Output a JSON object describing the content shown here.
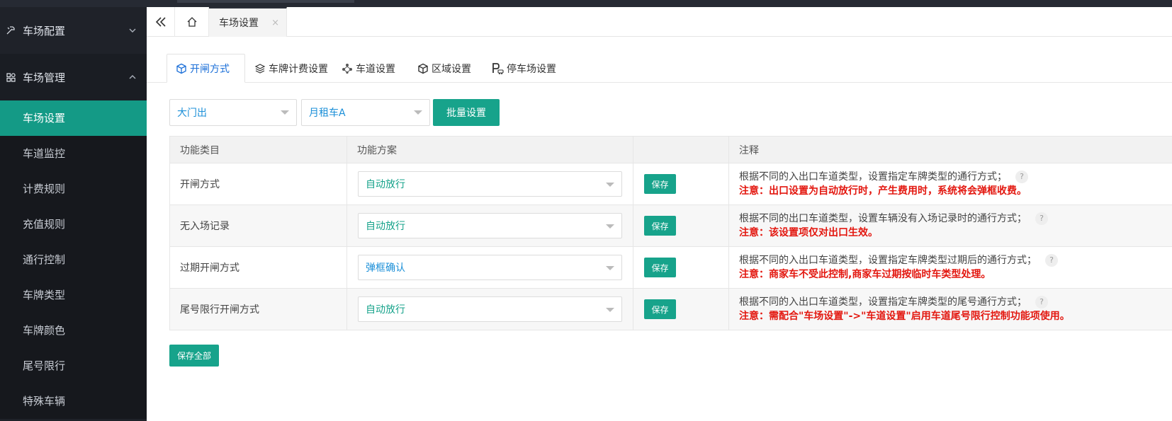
{
  "colors": {
    "accent": "#17a38b",
    "sidebar_bg": "#1f2229",
    "active_tab": "#1b6fd8",
    "warning": "#e3170f"
  },
  "sidebar": {
    "groups": [
      {
        "label": "车场配置",
        "icon": "tools-icon",
        "expanded": false
      },
      {
        "label": "车场管理",
        "icon": "grid-icon",
        "expanded": true
      }
    ],
    "items": [
      {
        "label": "车场设置",
        "active": true
      },
      {
        "label": "车道监控"
      },
      {
        "label": "计费规则"
      },
      {
        "label": "充值规则"
      },
      {
        "label": "通行控制"
      },
      {
        "label": "车牌类型"
      },
      {
        "label": "车牌颜色"
      },
      {
        "label": "尾号限行"
      },
      {
        "label": "特殊车辆"
      }
    ]
  },
  "tabbar": {
    "page_tab": "车场设置",
    "close": "×"
  },
  "subtabs": [
    {
      "label": "开闸方式",
      "icon": "cube-icon",
      "active": true
    },
    {
      "label": "车牌计费设置",
      "icon": "layers-icon"
    },
    {
      "label": "车道设置",
      "icon": "nodes-icon"
    },
    {
      "label": "区域设置",
      "icon": "box-icon"
    },
    {
      "label": "停车场设置",
      "icon": "parking-icon"
    }
  ],
  "filters": {
    "gate": "大门出",
    "car_type": "月租车A",
    "batch_button": "批量设置"
  },
  "table": {
    "headers": [
      "功能类目",
      "功能方案",
      "",
      "注释"
    ],
    "save_label": "保存",
    "rows": [
      {
        "category": "开闸方式",
        "plan": "自动放行",
        "note": "根据不同的入出口车道类型，设置指定车牌类型的通行方式；",
        "warning": "注意：出口设置为自动放行时，产生费用时，系统将会弹框收费。"
      },
      {
        "category": "无入场记录",
        "plan": "自动放行",
        "note": "根据不同的出口车道类型，设置车辆没有入场记录时的通行方式；",
        "warning": "注意：该设置项仅对出口生效。"
      },
      {
        "category": "过期开闸方式",
        "plan": "弹框确认",
        "note": "根据不同的入出口车道类型，设置指定车牌类型过期后的通行方式；",
        "warning": "注意：商家车不受此控制,商家车过期按临时车类型处理。"
      },
      {
        "category": "尾号限行开闸方式",
        "plan": "自动放行",
        "note": "根据不同的入出口车道类型，设置指定车牌类型的尾号通行方式；",
        "warning": "注意：需配合\"车场设置\"->\"车道设置\"启用车道尾号限行控制功能项使用。"
      }
    ]
  },
  "save_all": "保存全部"
}
